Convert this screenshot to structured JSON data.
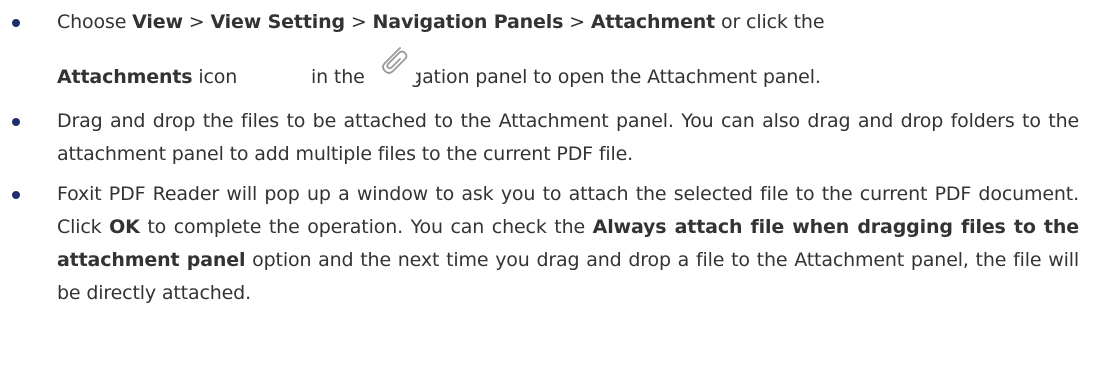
{
  "step1": {
    "line1_pre": "Choose ",
    "view": "View",
    "sep1": " > ",
    "view_setting": "View Setting",
    "sep2": " > ",
    "nav_panels": "Navigation Panels",
    "sep3": " > ",
    "attachment": "Attachment",
    "line1_post": " or click the",
    "attachments": "Attachments",
    "icon_word": " icon",
    "line2_post": "in the navigation panel to open the Attachment panel.",
    "icon_name": "paperclip-icon"
  },
  "step2": {
    "text": "Drag and drop the files to be attached to the Attachment panel. You can also drag and drop folders to the attachment panel to add multiple files to the current PDF file."
  },
  "step3": {
    "pre": "Foxit PDF Reader will pop up a window to ask you to attach the selected file to the current PDF document. Click ",
    "ok": "OK",
    "mid": " to complete the operation. You can check the ",
    "option": "Always attach file when dragging files to the attachment panel",
    "post": " option and the next time you drag and drop a file to the Attachment panel, the file will be directly attached."
  },
  "colors": {
    "bullet": "#1f2f6b",
    "text": "#333333"
  }
}
